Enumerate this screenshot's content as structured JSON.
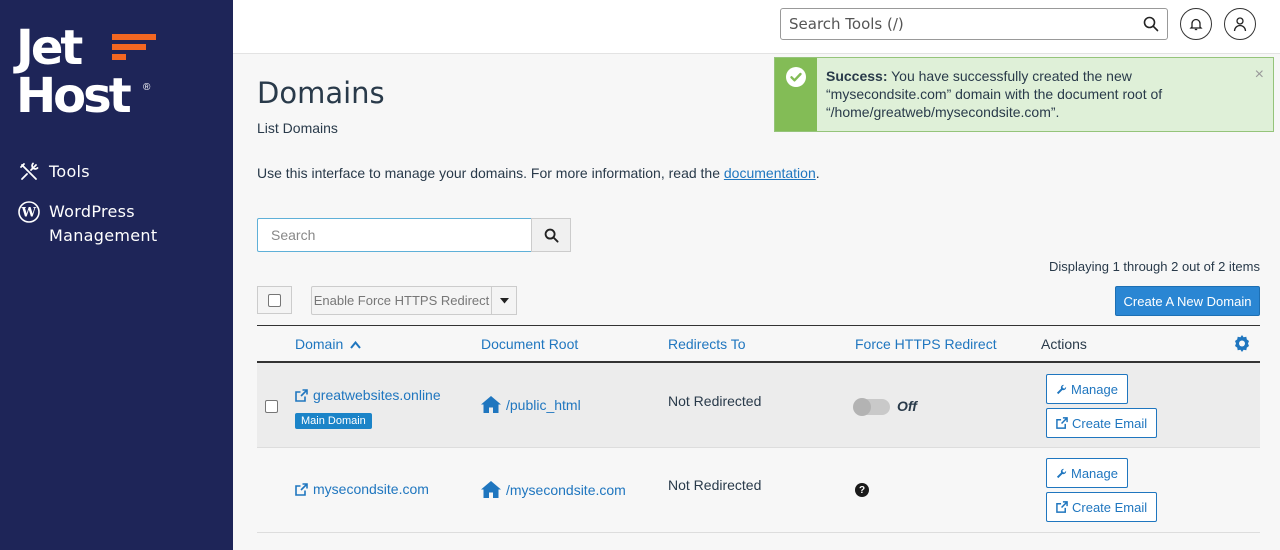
{
  "brand": {
    "line1": "Jet",
    "line2": "Host",
    "reg": "®",
    "accent": "#f26722"
  },
  "sidebar": {
    "items": [
      {
        "label": "Tools",
        "icon": "tools-icon"
      },
      {
        "label": "WordPress Management",
        "icon": "wordpress-icon"
      }
    ]
  },
  "header": {
    "search_placeholder": "Search Tools (/)",
    "icons": [
      "search-icon",
      "bell-icon",
      "user-icon"
    ]
  },
  "page": {
    "title": "Domains",
    "subtitle": "List Domains",
    "intro_text": "Use this interface to manage your domains. For more information, read the ",
    "intro_link": "documentation",
    "intro_end": "."
  },
  "alert": {
    "label": "Success:",
    "message": " You have successfully created the new “mysecondsite.com” domain with the document root of “/home/greatweb/mysecondsite.com”.",
    "close": "×"
  },
  "search": {
    "placeholder": "Search"
  },
  "toolbar": {
    "displaying": "Displaying 1 through 2 out of 2 items",
    "bulk_action": "Enable Force HTTPS Redirect",
    "create_button": "Create A New Domain"
  },
  "table": {
    "headers": {
      "domain": "Domain",
      "document_root": "Document Root",
      "redirects_to": "Redirects To",
      "force_https": "Force HTTPS Redirect",
      "actions": "Actions"
    },
    "rows": [
      {
        "domain": "greatwebsites.online",
        "badge": "Main Domain",
        "document_root": "/public_html",
        "redirects_to": "Not Redirected",
        "https_state": "Off",
        "manage": "Manage",
        "create_email": "Create Email"
      },
      {
        "domain": "mysecondsite.com",
        "document_root": "/mysecondsite.com",
        "redirects_to": "Not Redirected",
        "https_help": "?",
        "manage": "Manage",
        "create_email": "Create Email"
      }
    ]
  },
  "colors": {
    "sidebar": "#1e2558",
    "link": "#1f76bf",
    "primary": "#2a86d3",
    "success_bar": "#83bc56",
    "success_bg": "#dff0d8"
  }
}
